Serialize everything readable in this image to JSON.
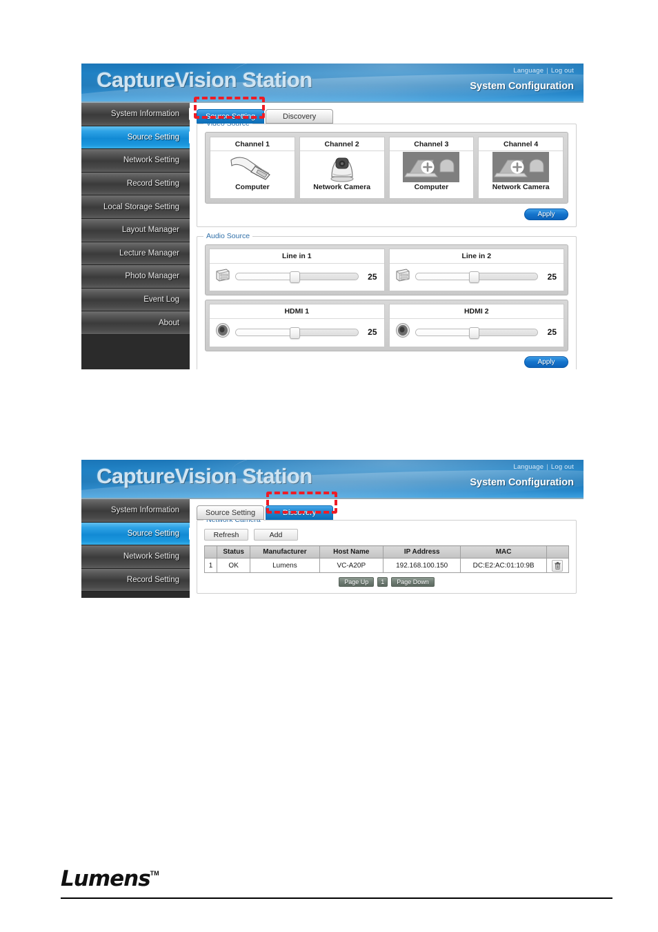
{
  "app": {
    "brand": "CaptureVision Station",
    "header_title": "System Configuration",
    "links": {
      "language": "Language",
      "separator": "|",
      "logout": "Log out"
    }
  },
  "sidebar": {
    "items": [
      {
        "label": "System Information",
        "active": false
      },
      {
        "label": "Source Setting",
        "active": true
      },
      {
        "label": "Network Setting",
        "active": false
      },
      {
        "label": "Record Setting",
        "active": false
      },
      {
        "label": "Local Storage Setting",
        "active": false
      },
      {
        "label": "Layout Manager",
        "active": false
      },
      {
        "label": "Lecture Manager",
        "active": false
      },
      {
        "label": "Photo Manager",
        "active": false
      },
      {
        "label": "Event Log",
        "active": false
      },
      {
        "label": "About",
        "active": false
      }
    ],
    "items_shot2": [
      {
        "label": "System Information",
        "active": false
      },
      {
        "label": "Source Setting",
        "active": true
      },
      {
        "label": "Network Setting",
        "active": false
      },
      {
        "label": "Record Setting",
        "active": false
      }
    ]
  },
  "screen1": {
    "tabs": [
      {
        "label": "Source Setting",
        "active": true
      },
      {
        "label": "Discovery",
        "active": false
      }
    ],
    "video_source": {
      "legend": "Video Source",
      "channels": [
        {
          "title": "Channel 1",
          "label": "Computer",
          "icon": "hdmi-connector-icon"
        },
        {
          "title": "Channel 2",
          "label": "Network Camera",
          "icon": "ptz-camera-icon"
        },
        {
          "title": "Channel 3",
          "label": "Computer",
          "icon": "add-source-thumbnail-icon"
        },
        {
          "title": "Channel 4",
          "label": "Network Camera",
          "icon": "add-source-thumbnail-icon"
        }
      ],
      "apply_label": "Apply"
    },
    "audio_source": {
      "legend": "Audio Source",
      "rows": [
        [
          {
            "title": "Line in 1",
            "value": "25",
            "icon": "line-in-jack-icon"
          },
          {
            "title": "Line in 2",
            "value": "25",
            "icon": "line-in-jack-icon"
          }
        ],
        [
          {
            "title": "HDMI 1",
            "value": "25",
            "icon": "speaker-icon"
          },
          {
            "title": "HDMI 2",
            "value": "25",
            "icon": "speaker-icon"
          }
        ]
      ],
      "apply_label": "Apply"
    }
  },
  "screen2": {
    "tabs": [
      {
        "label": "Source Setting",
        "active": false
      },
      {
        "label": "Discovery",
        "active": true
      }
    ],
    "network_camera": {
      "legend": "Network Camera",
      "buttons": {
        "refresh": "Refresh",
        "add": "Add"
      },
      "columns": [
        "",
        "Status",
        "Manufacturer",
        "Host Name",
        "IP Address",
        "MAC",
        ""
      ],
      "rows": [
        {
          "index": "1",
          "status": "OK",
          "manufacturer": "Lumens",
          "host_name": "VC-A20P",
          "ip_address": "192.168.100.150",
          "mac": "DC:E2:AC:01:10:9B",
          "delete_icon": "trash-icon"
        }
      ],
      "pager": {
        "prev": "Page Up",
        "page": "1",
        "next": "Page Down"
      }
    }
  },
  "footer": {
    "logo": "Lumens",
    "tm": "TM"
  },
  "colors": {
    "accent_blue": "#1b76b8",
    "active_nav": "#128ad4",
    "annotation_red": "#ee1c25",
    "legend_blue": "#2f6fa8"
  }
}
